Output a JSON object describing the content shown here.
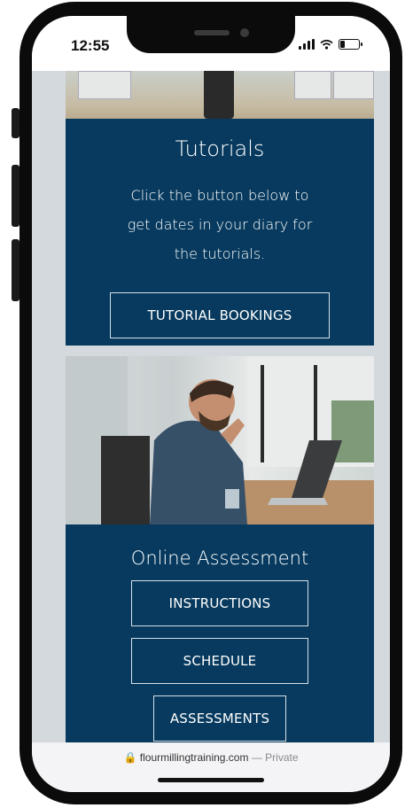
{
  "status_bar": {
    "time": "12:55"
  },
  "tutorials": {
    "title": "Tutorials",
    "line1": "Click the button below to",
    "line2": "get dates in your diary for",
    "line3": "the tutorials.",
    "button": "TUTORIAL BOOKINGS"
  },
  "assessment": {
    "title": "Online Assessment",
    "buttons": [
      "INSTRUCTIONS",
      "SCHEDULE",
      "ASSESSMENTS"
    ]
  },
  "browser": {
    "domain": "flourmillingtraining.com",
    "mode": "— Private"
  },
  "colors": {
    "card_bg": "#073a5e",
    "page_bg": "#d3d9dd"
  }
}
